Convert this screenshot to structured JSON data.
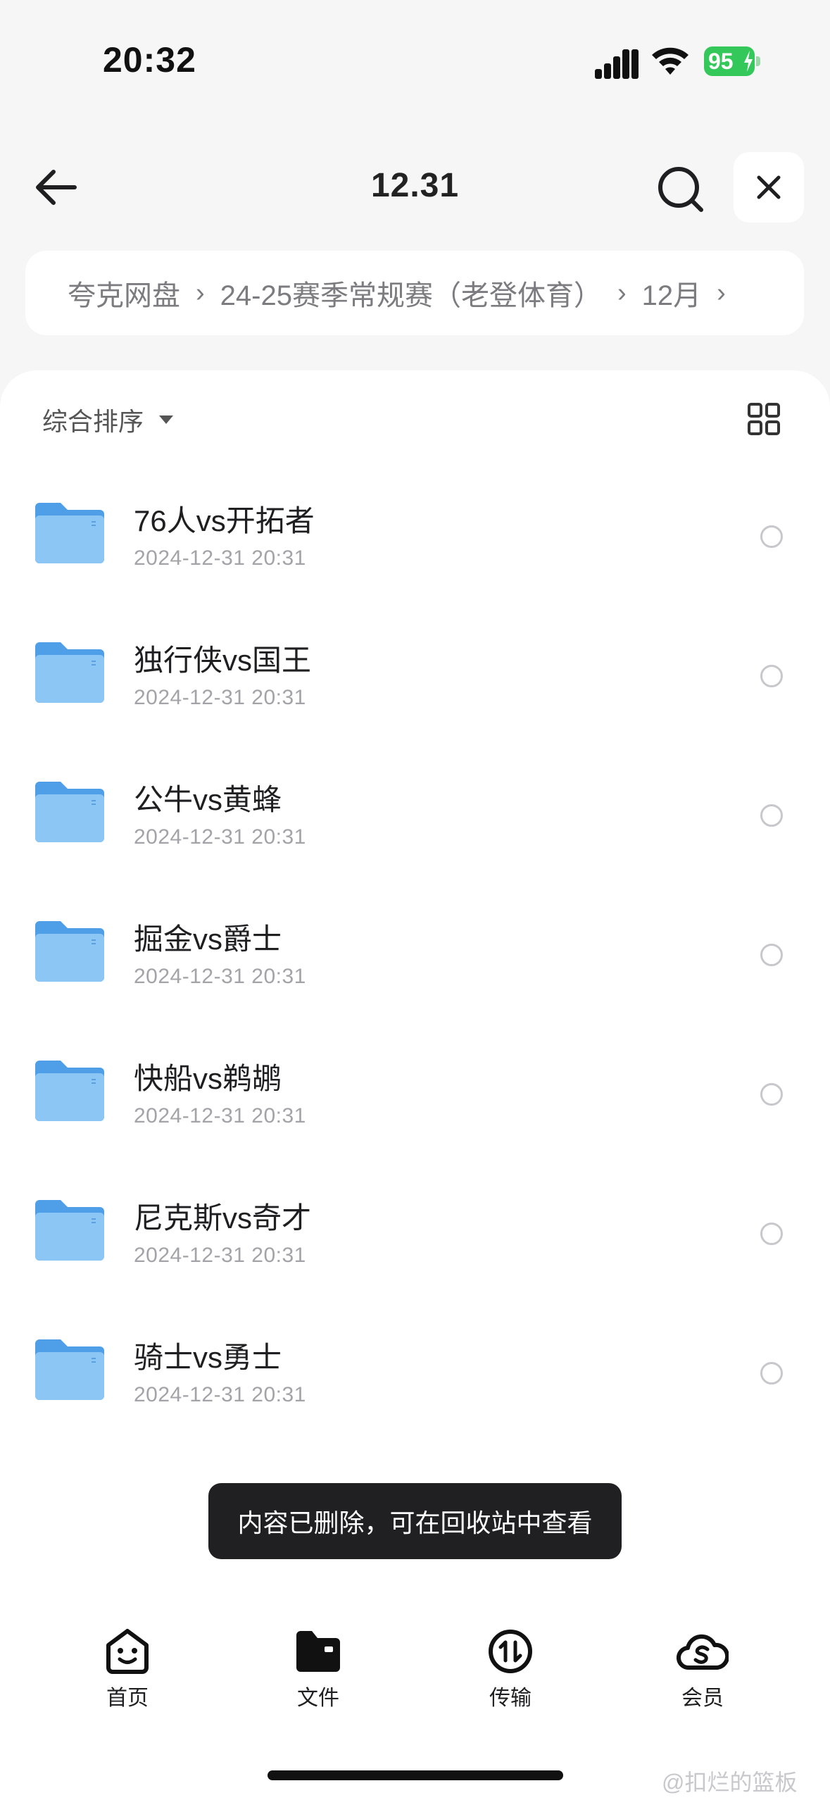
{
  "status_bar": {
    "time": "20:32",
    "battery": "95"
  },
  "header": {
    "title": "12.31"
  },
  "breadcrumb": [
    "夸克网盘",
    "24-25赛季常规赛（老登体育）",
    "12月"
  ],
  "toolbar": {
    "sort_label": "综合排序"
  },
  "files": [
    {
      "name": "76人vs开拓者",
      "date": "2024-12-31 20:31"
    },
    {
      "name": "独行侠vs国王",
      "date": "2024-12-31 20:31"
    },
    {
      "name": "公牛vs黄蜂",
      "date": "2024-12-31 20:31"
    },
    {
      "name": "掘金vs爵士",
      "date": "2024-12-31 20:31"
    },
    {
      "name": "快船vs鹈鹕",
      "date": "2024-12-31 20:31"
    },
    {
      "name": "尼克斯vs奇才",
      "date": "2024-12-31 20:31"
    },
    {
      "name": "骑士vs勇士",
      "date": "2024-12-31 20:31"
    }
  ],
  "toast": "内容已删除，可在回收站中查看",
  "tabs": [
    {
      "label": "首页",
      "icon": "home-face-icon"
    },
    {
      "label": "文件",
      "icon": "folder-icon"
    },
    {
      "label": "传输",
      "icon": "transfer-icon"
    },
    {
      "label": "会员",
      "icon": "vip-cloud-icon"
    }
  ],
  "watermark": "@扣烂的篮板",
  "colors": {
    "accent_folder": "#5aa9ef",
    "battery": "#34c759",
    "toast_bg": "#202022"
  }
}
